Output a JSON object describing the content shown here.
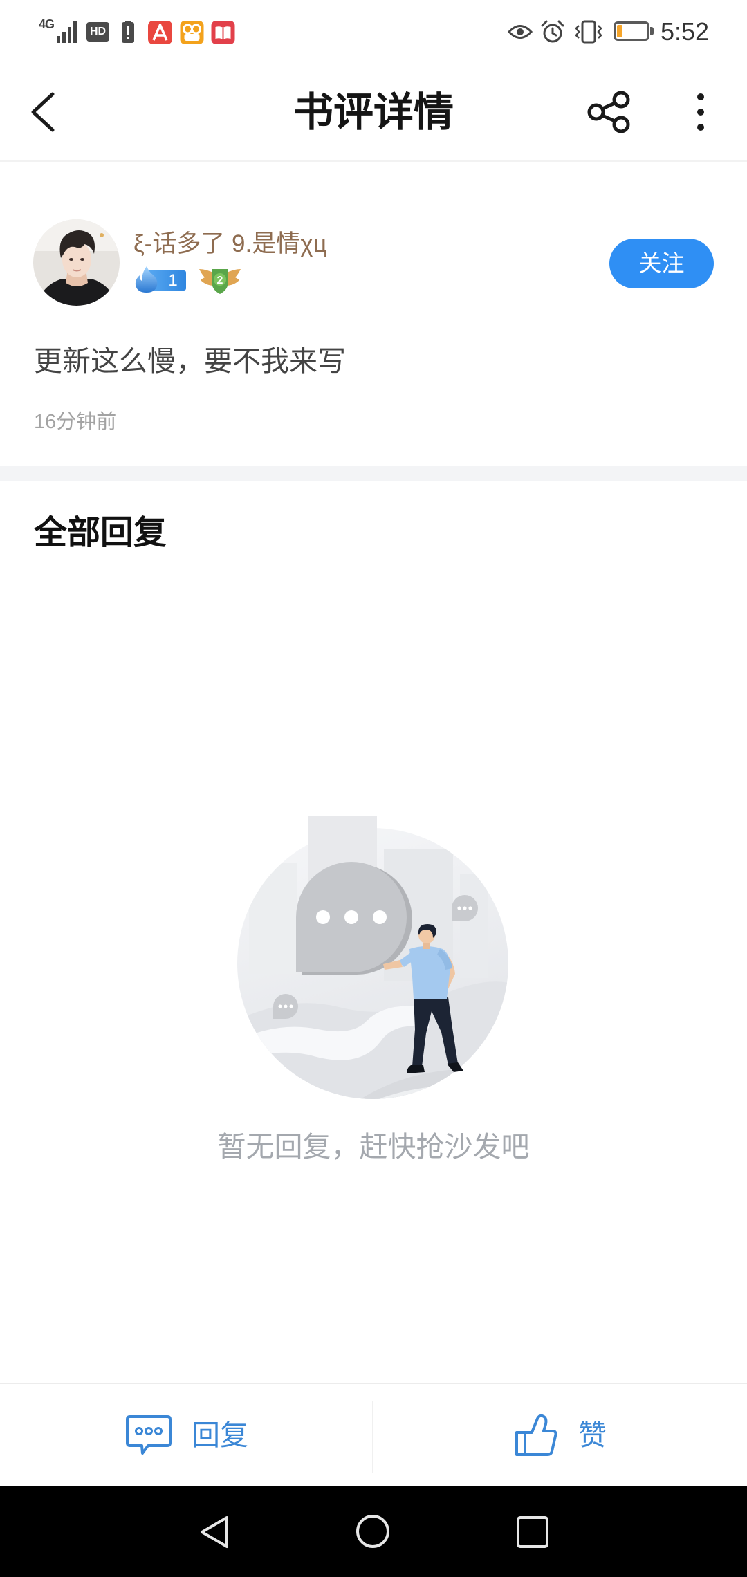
{
  "status_bar": {
    "network": "4G",
    "hd_label": "HD",
    "time": "5:52",
    "battery_percent": 20,
    "icons": [
      "signal-icon",
      "hd-icon",
      "battery-alert-icon",
      "app-a-icon",
      "app-orange-icon",
      "app-book-icon",
      "eye-icon",
      "alarm-icon",
      "vibrate-icon",
      "battery-icon"
    ]
  },
  "header": {
    "title": "书评详情",
    "icons": [
      "back-icon",
      "share-icon",
      "more-icon"
    ]
  },
  "review": {
    "username": "ξ-话多了 9.是情χц",
    "fan_level": "1",
    "badge_level": "2",
    "follow_label": "关注",
    "content": "更新这么慢，要不我来写",
    "time_ago": "16分钟前"
  },
  "replies": {
    "title": "全部回复",
    "empty_text": "暂无回复，赶快抢沙发吧"
  },
  "bottom_bar": {
    "reply_label": "回复",
    "like_label": "赞",
    "icons": [
      "comment-icon",
      "thumbs-up-icon"
    ]
  },
  "nav_bar": {
    "icons": [
      "nav-back-icon",
      "nav-home-icon",
      "nav-recents-icon"
    ]
  },
  "colors": {
    "accent": "#2f8ff4",
    "action": "#3b87d6",
    "username": "#8e6c50",
    "muted_text": "#a4a8ae",
    "battery_low": "#f6a52a"
  }
}
